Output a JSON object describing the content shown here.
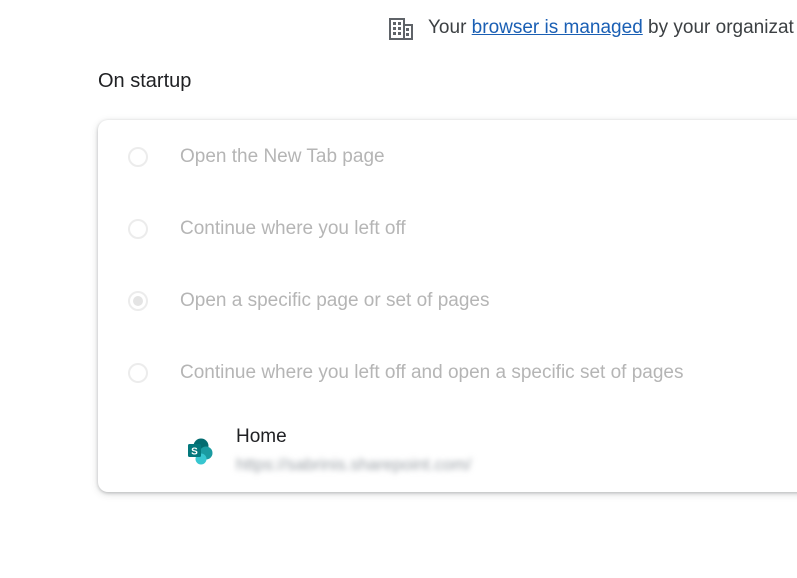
{
  "banner": {
    "prefix": "Your ",
    "link": "browser is managed",
    "suffix": " by your organizat",
    "icon": "building-icon"
  },
  "section": {
    "title": "On startup"
  },
  "options": [
    {
      "label": "Open the New Tab page",
      "selected": false
    },
    {
      "label": "Continue where you left off",
      "selected": false
    },
    {
      "label": "Open a specific page or set of pages",
      "selected": true
    },
    {
      "label": "Continue where you left off and open a specific set of pages",
      "selected": false
    }
  ],
  "startup_pages": [
    {
      "title": "Home",
      "url": "https://sabrinis.sharepoint.com/",
      "icon": "sharepoint-icon"
    }
  ],
  "colors": {
    "link": "#1a5fb4",
    "disabled_text": "#b5b5b5",
    "sharepoint_teal": "#038387"
  }
}
